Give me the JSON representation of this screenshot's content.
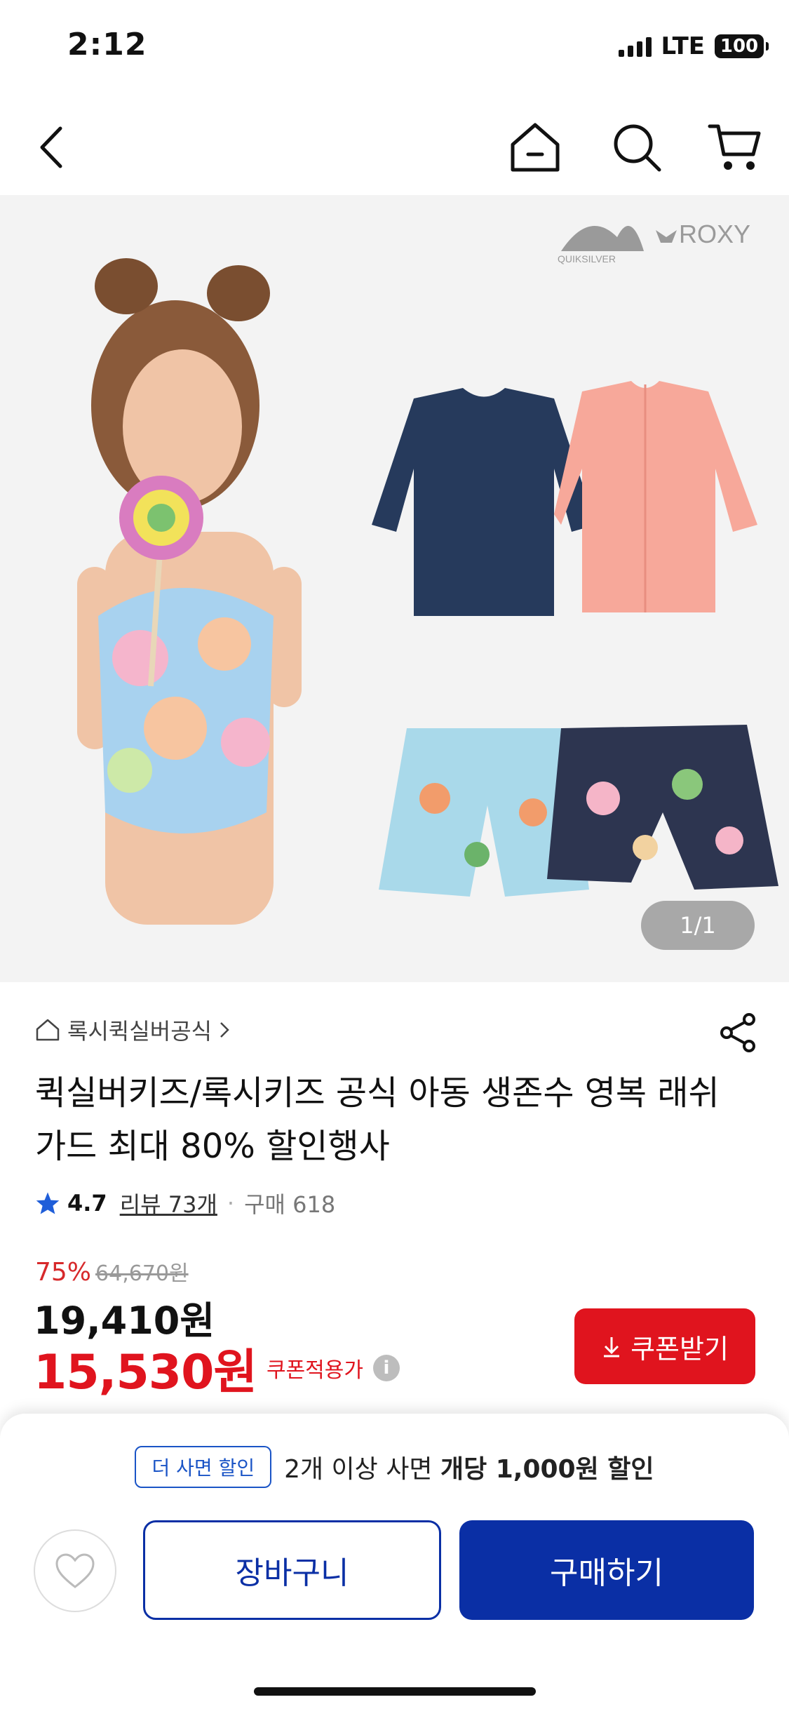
{
  "status_bar": {
    "time": "2:12",
    "network": "LTE",
    "battery": "100"
  },
  "top_nav": {
    "back_icon": "chevron-left-icon",
    "home_icon": "home-icon",
    "search_icon": "search-icon",
    "cart_icon": "cart-icon"
  },
  "hero": {
    "brands": [
      "QUIKSILVER",
      "ROXY"
    ],
    "page_indicator": "1/1"
  },
  "product": {
    "seller": "록시퀵실버공식",
    "title": "퀵실버키즈/록시키즈 공식 아동 생존수 영복 래쉬가드 최대 80% 할인행사",
    "rating": "4.7",
    "review_label": "리뷰 73개",
    "purchase_label": "구매 618",
    "discount_rate": "75%",
    "original_price": "64,670원",
    "sale_price": "19,410원",
    "coupon_price": "15,530원",
    "coupon_price_label": "쿠폰적용가",
    "coupon_button": "쿠폰받기"
  },
  "bottom_bar": {
    "promo_badge": "더 사면 할인",
    "promo_text_prefix": "2개 이상 사면",
    "promo_text_bold": "개당 1,000원 할인",
    "cart_button": "장바구니",
    "buy_button": "구매하기"
  },
  "colors": {
    "accent_red": "#e0141e",
    "primary_blue": "#0a2fa5",
    "rating_star": "#1f5ed9"
  }
}
